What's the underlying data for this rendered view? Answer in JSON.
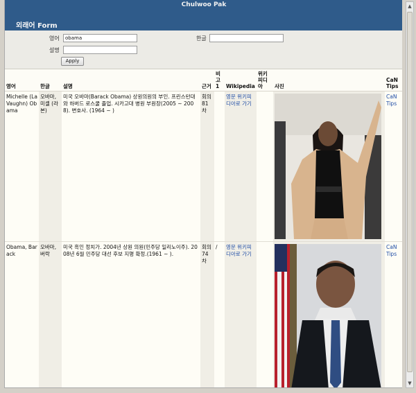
{
  "header": {
    "site_title": "Chulwoo Pak",
    "form_title": "외래어 Form"
  },
  "filter": {
    "label_english": "영어",
    "value_english": "obama",
    "label_korean": "한글",
    "value_korean": "",
    "label_desc": "설명",
    "value_desc": "",
    "apply_label": "Apply"
  },
  "table": {
    "headers": {
      "english": "영어",
      "korean": "한글",
      "desc": "설명",
      "kun": "근거",
      "bigo": "비고1",
      "wikipedia": "Wikipedia",
      "wiki_ko": "위키피디아",
      "photo": "사진",
      "tips": "CaN Tips"
    },
    "rows": [
      {
        "english": "Michelle (La Vaughn) Obama",
        "korean": "오바마, 미셸 (라본)",
        "desc": "미국 오바마(Barack Obama) 상원의원의 부인. 프린스턴대와 하버드 로스쿨 졸업. 시카고대 병원 부원장(2005 ~ 2008). 변호사. (1964 ~ )",
        "kun": "회의81차",
        "bigo": "",
        "wikipedia": "영문 위키피디아로 가기",
        "wiki_ko": "",
        "tips": "CaN Tips"
      },
      {
        "english": "Obama, Barack",
        "korean": "오바마, 버락",
        "desc": "미국 흑인 정치가. 2004년 상원 의원(민주당 일리노이주). 2008년 6월 민주당 대선 후보 지명 확정.(1961 ~ ).",
        "kun": "회의74차",
        "bigo": "/",
        "wikipedia": "영문 위키피디아로 가기",
        "wiki_ko": "",
        "tips": "CaN Tips"
      }
    ]
  }
}
